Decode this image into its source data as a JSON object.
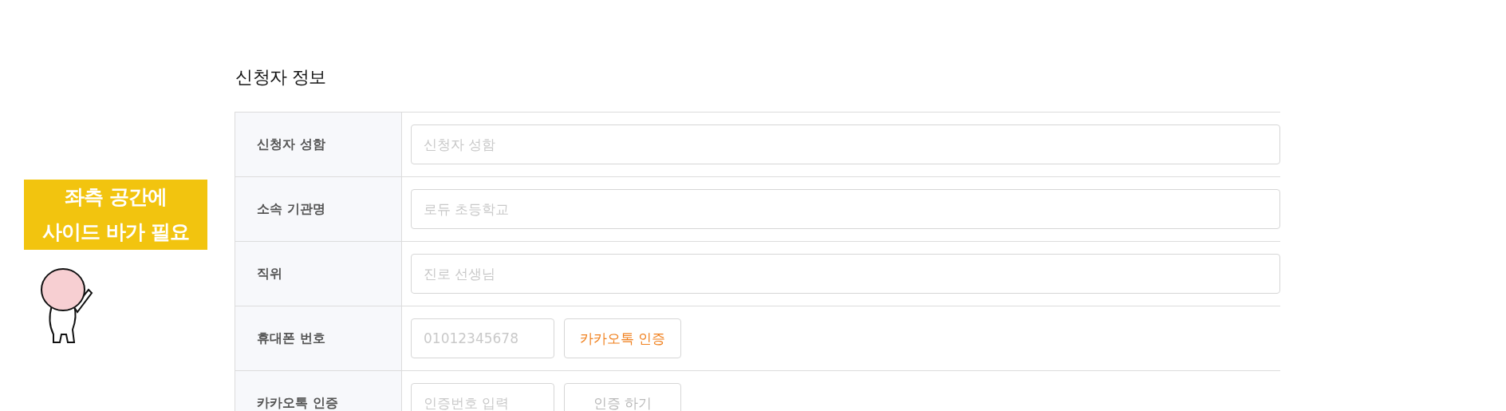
{
  "notice": {
    "lines": [
      "좌측 공간에",
      "사이드 바가 필요"
    ]
  },
  "section": {
    "title": "신청자 정보"
  },
  "rows": [
    {
      "label": "신청자 성함",
      "kind": "wide",
      "field": {
        "placeholder": "신청자 성함"
      }
    },
    {
      "label": "소속 기관명",
      "kind": "wide",
      "field": {
        "placeholder": "로듀 초등학교"
      }
    },
    {
      "label": "직위",
      "kind": "wide",
      "field": {
        "placeholder": "진로 선생님"
      }
    },
    {
      "label": "휴대폰 번호",
      "kind": "action",
      "field": {
        "placeholder": "01012345678"
      },
      "button": {
        "label": "카카오톡 인증",
        "disabled": false
      }
    },
    {
      "label": "카카오톡 인증",
      "kind": "action",
      "field": {
        "placeholder": "인증번호 입력"
      },
      "button": {
        "label": "인증 하기",
        "disabled": true
      }
    }
  ]
}
